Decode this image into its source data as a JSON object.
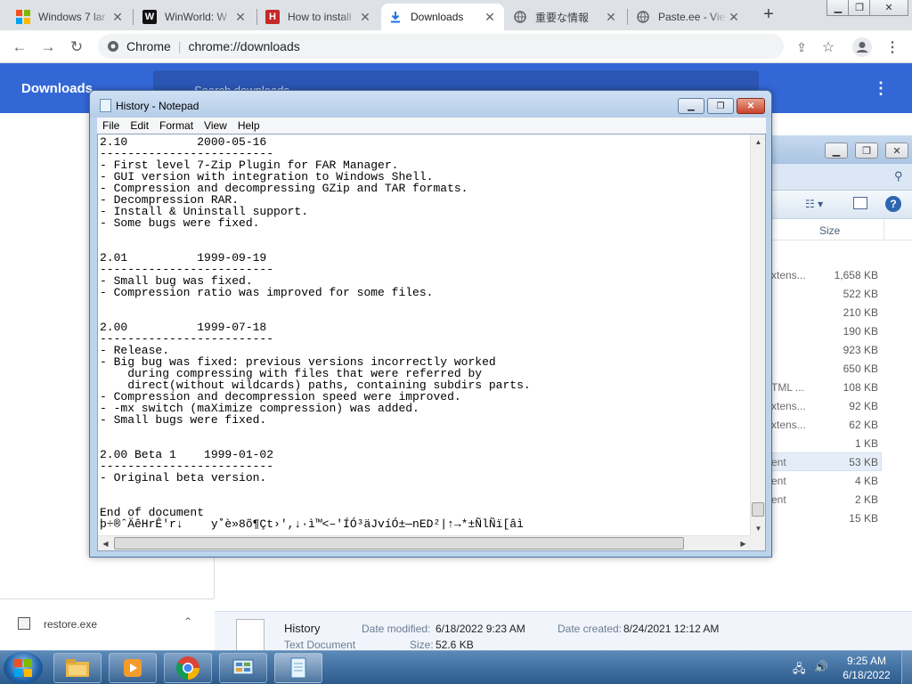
{
  "browser": {
    "tabs": [
      {
        "title": "Windows 7 lar",
        "favicon": "windows-logo-icon",
        "active": false
      },
      {
        "title": "WinWorld: W",
        "favicon": "winworld-w-icon",
        "active": false
      },
      {
        "title": "How to install",
        "favicon": "h-logo-icon",
        "active": false
      },
      {
        "title": "Downloads",
        "favicon": "download-icon",
        "active": true
      },
      {
        "title": "重要な情報",
        "favicon": "globe-icon",
        "active": false
      },
      {
        "title": "Paste.ee - Vie",
        "favicon": "globe-icon",
        "active": false
      }
    ],
    "new_tab": "+",
    "address": {
      "site_label": "Chrome",
      "url": "chrome://downloads"
    }
  },
  "downloads": {
    "title": "Downloads",
    "search_placeholder": "Search downloads",
    "shelf_item": "restore.exe"
  },
  "explorer": {
    "column_size": "Size",
    "rows": [
      {
        "type": "xtens...",
        "size": "1,658 KB"
      },
      {
        "type": "",
        "size": "522 KB"
      },
      {
        "type": "",
        "size": "210 KB"
      },
      {
        "type": "",
        "size": "190 KB"
      },
      {
        "type": "",
        "size": "923 KB"
      },
      {
        "type": "",
        "size": "650 KB"
      },
      {
        "type": "TML ...",
        "size": "108 KB"
      },
      {
        "type": "xtens...",
        "size": "92 KB"
      },
      {
        "type": "xtens...",
        "size": "62 KB"
      },
      {
        "type": "",
        "size": "1 KB"
      },
      {
        "type": "ent",
        "size": "53 KB",
        "selected": true
      },
      {
        "type": "ent",
        "size": "4 KB"
      },
      {
        "type": "ent",
        "size": "2 KB"
      },
      {
        "type": "",
        "size": "15 KB"
      }
    ],
    "details": {
      "name": "History",
      "kind": "Text Document",
      "modified_label": "Date modified:",
      "modified_value": "6/18/2022 9:23 AM",
      "created_label": "Date created:",
      "created_value": "8/24/2021 12:12 AM",
      "size_label": "Size:",
      "size_value": "52.6 KB"
    }
  },
  "notepad": {
    "title": "History - Notepad",
    "menu": [
      "File",
      "Edit",
      "Format",
      "View",
      "Help"
    ],
    "content": "2.10          2000-05-16\n-------------------------\n- First level 7-Zip Plugin for FAR Manager.\n- GUI version with integration to Windows Shell.\n- Compression and decompressing GZip and TAR formats.\n- Decompression RAR.\n- Install & Uninstall support.\n- Some bugs were fixed.\n\n\n2.01          1999-09-19\n-------------------------\n- Small bug was fixed.\n- Compression ratio was improved for some files.\n\n\n2.00          1999-07-18\n-------------------------\n- Release.\n- Big bug was fixed: previous versions incorrectly worked\n    during compressing with files that were referred by\n    direct(without wildcards) paths, containing subdirs parts.\n- Compression and decompression speed were improved.\n- -mx switch (maXimize compression) was added.\n- Small bugs were fixed.\n\n\n2.00 Beta 1    1999-01-02\n-------------------------\n- Original beta version.\n\n\nEnd of document\nþ÷®ˆÄêHrÊ'r↓    y˚è»8õ¶Çt›',↓·ì™<–'ÍÓ³äJvíÓ±—nED²|↑→*±ÑlÑï[âì"
  },
  "taskbar": {
    "apps": [
      "explorer-folder-icon",
      "media-player-icon",
      "chrome-icon",
      "control-panel-icon",
      "notepad-icon"
    ],
    "time": "9:25 AM",
    "date": "6/18/2022"
  }
}
